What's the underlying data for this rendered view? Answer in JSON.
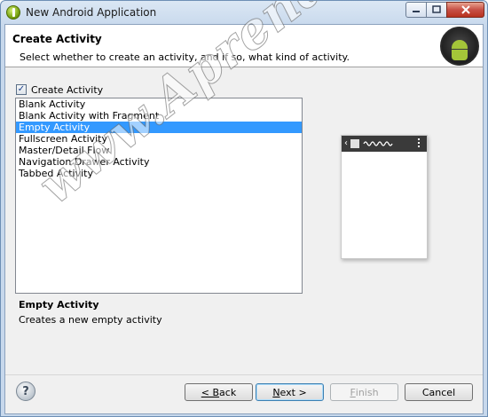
{
  "window": {
    "title": "New Android Application"
  },
  "header": {
    "title": "Create Activity",
    "description": "Select whether to create an activity, and if so, what kind of activity."
  },
  "create_activity": {
    "label": "Create Activity",
    "checked": true,
    "check_glyph": "✓"
  },
  "activity_list": {
    "items": [
      "Blank Activity",
      "Blank Activity with Fragment",
      "Empty Activity",
      "Fullscreen Activity",
      "Master/Detail Flow",
      "Navigation Drawer Activity",
      "Tabbed Activity"
    ],
    "selected": "Empty Activity"
  },
  "details": {
    "title": "Empty Activity",
    "text": "Creates a new empty activity"
  },
  "buttons": {
    "back_mnemonic": "< B",
    "back_rest": "ack",
    "next_mnemonic": "N",
    "next_rest": "ext >",
    "finish_mnemonic": "F",
    "finish_rest": "inish",
    "cancel": "Cancel"
  },
  "help": {
    "glyph": "?"
  },
  "watermark": "www.AprendeAndroid.com",
  "colors": {
    "selection": "#3399ff",
    "android_green": "#a4c639"
  }
}
